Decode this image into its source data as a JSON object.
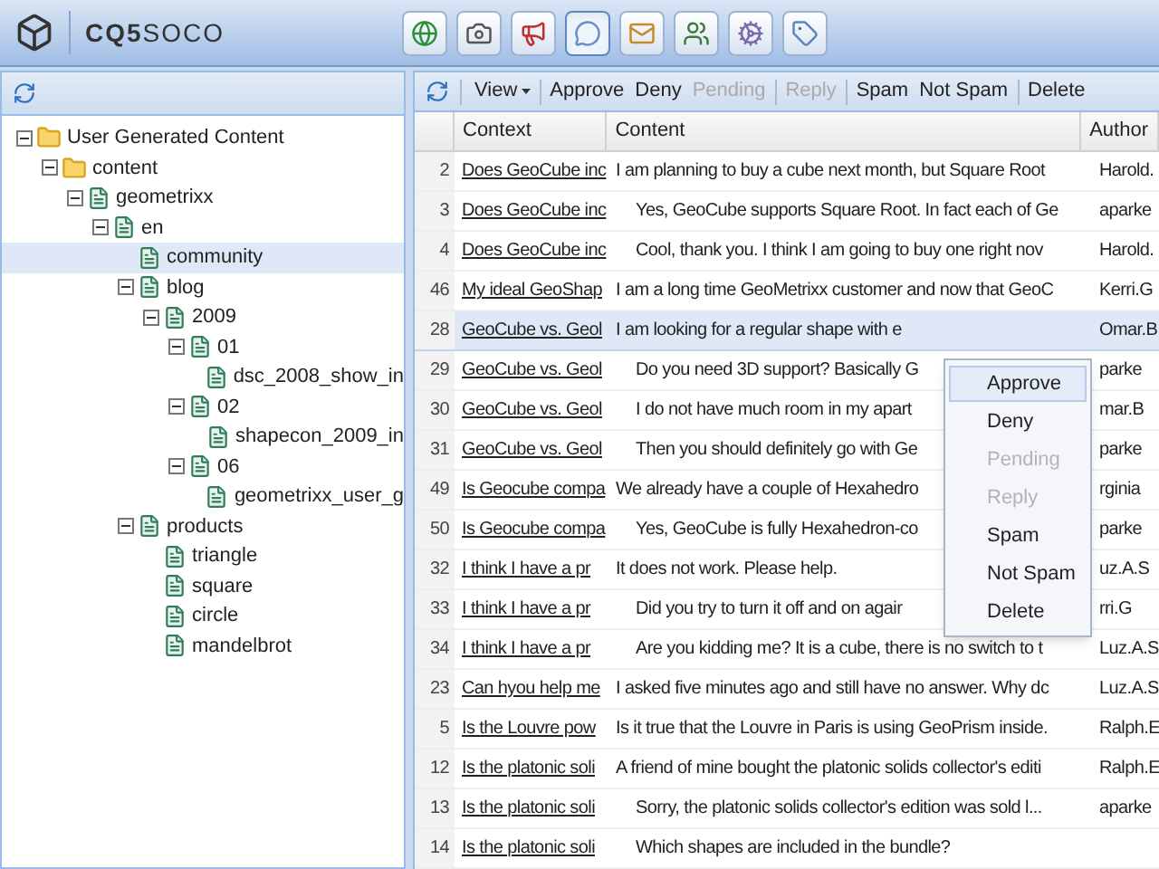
{
  "header": {
    "brand_main": "CQ5",
    "brand_sub": "SOCO"
  },
  "nav_icons": [
    {
      "kind": "globe",
      "selected": false
    },
    {
      "kind": "camera",
      "selected": false
    },
    {
      "kind": "megaphone",
      "selected": false
    },
    {
      "kind": "comment",
      "selected": true
    },
    {
      "kind": "mail",
      "selected": false
    },
    {
      "kind": "users",
      "selected": false
    },
    {
      "kind": "cog",
      "selected": false
    },
    {
      "kind": "tag",
      "selected": false
    }
  ],
  "tree": [
    {
      "label": "User Generated Content",
      "kind": "folder",
      "expanded": true,
      "selected": false,
      "children": [
        {
          "label": "content",
          "kind": "folder",
          "expanded": true,
          "selected": false,
          "children": [
            {
              "label": "geometrixx",
              "kind": "page",
              "expanded": true,
              "selected": false,
              "children": [
                {
                  "label": "en",
                  "kind": "page",
                  "expanded": true,
                  "selected": false,
                  "children": [
                    {
                      "label": "community",
                      "kind": "page",
                      "selected": true
                    },
                    {
                      "label": "blog",
                      "kind": "page",
                      "expanded": true,
                      "selected": false,
                      "children": [
                        {
                          "label": "2009",
                          "kind": "page",
                          "expanded": true,
                          "selected": false,
                          "children": [
                            {
                              "label": "01",
                              "kind": "page",
                              "expanded": true,
                              "selected": false,
                              "children": [
                                {
                                  "label": "dsc_2008_show_in",
                                  "kind": "page",
                                  "selected": false
                                }
                              ]
                            },
                            {
                              "label": "02",
                              "kind": "page",
                              "expanded": true,
                              "selected": false,
                              "children": [
                                {
                                  "label": "shapecon_2009_in",
                                  "kind": "page",
                                  "selected": false
                                }
                              ]
                            },
                            {
                              "label": "06",
                              "kind": "page",
                              "expanded": true,
                              "selected": false,
                              "children": [
                                {
                                  "label": "geometrixx_user_g",
                                  "kind": "page",
                                  "selected": false
                                }
                              ]
                            }
                          ]
                        }
                      ]
                    },
                    {
                      "label": "products",
                      "kind": "page",
                      "expanded": true,
                      "selected": false,
                      "children": [
                        {
                          "label": "triangle",
                          "kind": "page",
                          "selected": false
                        },
                        {
                          "label": "square",
                          "kind": "page",
                          "selected": false
                        },
                        {
                          "label": "circle",
                          "kind": "page",
                          "selected": false
                        },
                        {
                          "label": "mandelbrot",
                          "kind": "page",
                          "selected": false
                        }
                      ]
                    }
                  ]
                }
              ]
            }
          ]
        }
      ]
    }
  ],
  "toolbar": [
    {
      "label": "View",
      "kind": "dropdown",
      "disabled": false,
      "separator_before": false
    },
    {
      "label": "Approve",
      "kind": "button",
      "disabled": false,
      "separator_before": true
    },
    {
      "label": "Deny",
      "kind": "button",
      "disabled": false,
      "separator_before": false
    },
    {
      "label": "Pending",
      "kind": "button",
      "disabled": true,
      "separator_before": false
    },
    {
      "label": "Reply",
      "kind": "button",
      "disabled": true,
      "separator_before": true
    },
    {
      "label": "Spam",
      "kind": "button",
      "disabled": false,
      "separator_before": true
    },
    {
      "label": "Not Spam",
      "kind": "button",
      "disabled": false,
      "separator_before": false
    },
    {
      "label": "Delete",
      "kind": "button",
      "disabled": false,
      "separator_before": true
    }
  ],
  "table": {
    "columns": [
      "Context",
      "Content",
      "Author"
    ],
    "rows": [
      {
        "num": "2",
        "context": "Does GeoCube inc",
        "content": "I am planning to buy a cube next month, but Square Root",
        "author": "Harold.",
        "reply": false,
        "selected": false
      },
      {
        "num": "3",
        "context": "Does GeoCube inc",
        "content": "Yes, GeoCube supports Square Root. In fact each of Ge",
        "author": "aparke",
        "reply": true,
        "selected": false
      },
      {
        "num": "4",
        "context": "Does GeoCube inc",
        "content": "Cool, thank you. I think I am going to buy one right nov",
        "author": "Harold.",
        "reply": true,
        "selected": false
      },
      {
        "num": "46",
        "context": "My ideal GeoShap",
        "content": "I am a long time GeoMetrixx customer and now that GeoC",
        "author": "Kerri.G",
        "reply": false,
        "selected": false
      },
      {
        "num": "28",
        "context": "GeoCube vs. Geol",
        "content": "I am looking for a regular shape with e",
        "author": "Omar.B",
        "reply": false,
        "selected": true
      },
      {
        "num": "29",
        "context": "GeoCube vs. Geol",
        "content": "Do you need 3D support? Basically G",
        "author": "parke",
        "reply": true,
        "selected": false
      },
      {
        "num": "30",
        "context": "GeoCube vs. Geol",
        "content": "I do not have much room in my apart",
        "author": "mar.B",
        "reply": true,
        "selected": false
      },
      {
        "num": "31",
        "context": "GeoCube vs. Geol",
        "content": "Then you should definitely go with Ge",
        "author": "parke",
        "reply": true,
        "selected": false
      },
      {
        "num": "49",
        "context": "Is Geocube compa",
        "content": "We already have a couple of Hexahedro",
        "author": "rginia",
        "reply": false,
        "selected": false
      },
      {
        "num": "50",
        "context": "Is Geocube compa",
        "content": "Yes, GeoCube is fully Hexahedron-co",
        "author": "parke",
        "reply": true,
        "selected": false
      },
      {
        "num": "32",
        "context": "I think I have a pr",
        "content": "It does not work. Please help.",
        "author": "uz.A.S",
        "reply": false,
        "selected": false
      },
      {
        "num": "33",
        "context": "I think I have a pr",
        "content": "Did you try to turn it off and on agair",
        "author": "rri.G",
        "reply": true,
        "selected": false
      },
      {
        "num": "34",
        "context": "I think I have a pr",
        "content": "Are you kidding me? It is a cube, there is no switch to t",
        "author": "Luz.A.S",
        "reply": true,
        "selected": false
      },
      {
        "num": "23",
        "context": "Can hyou help me",
        "content": "I asked five minutes ago and still have no answer. Why dc",
        "author": "Luz.A.S",
        "reply": false,
        "selected": false
      },
      {
        "num": "5",
        "context": "Is the Louvre pow",
        "content": "Is it true that the Louvre in Paris is using GeoPrism inside.",
        "author": "Ralph.E",
        "reply": false,
        "selected": false
      },
      {
        "num": "12",
        "context": "Is the platonic soli",
        "content": "A friend of mine bought the platonic solids collector's editi",
        "author": "Ralph.E",
        "reply": false,
        "selected": false
      },
      {
        "num": "13",
        "context": "Is the platonic soli",
        "content": "Sorry, the platonic solids collector's edition was sold l...",
        "author": "aparke",
        "reply": true,
        "selected": false
      },
      {
        "num": "14",
        "context": "Is the platonic soli",
        "content": "Which shapes are included in the bundle?",
        "reply": true,
        "selected": false
      }
    ]
  },
  "context_menu": [
    {
      "label": "Approve",
      "disabled": false,
      "highlighted": true
    },
    {
      "label": "Deny",
      "disabled": false,
      "highlighted": false
    },
    {
      "label": "Pending",
      "disabled": true,
      "highlighted": false
    },
    {
      "label": "Reply",
      "disabled": true,
      "highlighted": false
    },
    {
      "label": "Spam",
      "disabled": false,
      "highlighted": false
    },
    {
      "label": "Not Spam",
      "disabled": false,
      "highlighted": false
    },
    {
      "label": "Delete",
      "disabled": false,
      "highlighted": false
    }
  ]
}
